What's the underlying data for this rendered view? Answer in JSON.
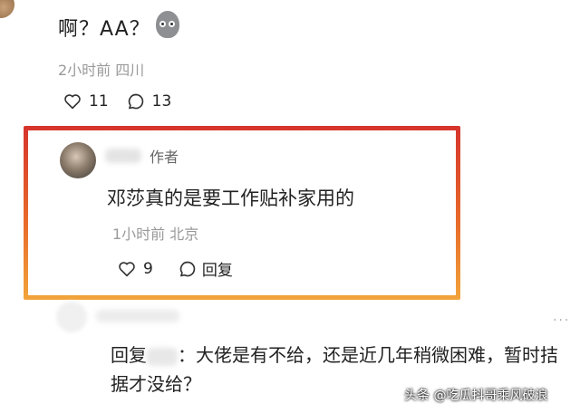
{
  "top_comment": {
    "text": "啊？AA？",
    "meta": "2小时前 四川",
    "likes": "11",
    "replies": "13"
  },
  "author_comment": {
    "tag": "作者",
    "text": "邓莎真的是要工作贴补家用的",
    "meta": "1小时前 北京",
    "likes": "9",
    "reply_label": "回复"
  },
  "reply_comment": {
    "prefix": "回复",
    "text": "：大佬是有不给，还是近几年稍微困难，暂时拮据才没给？"
  },
  "watermark": "头条 @吃瓜抖哥乘风破浪",
  "colors": {
    "highlight_top": "#d6342c",
    "highlight_bottom": "#f2a43a"
  }
}
